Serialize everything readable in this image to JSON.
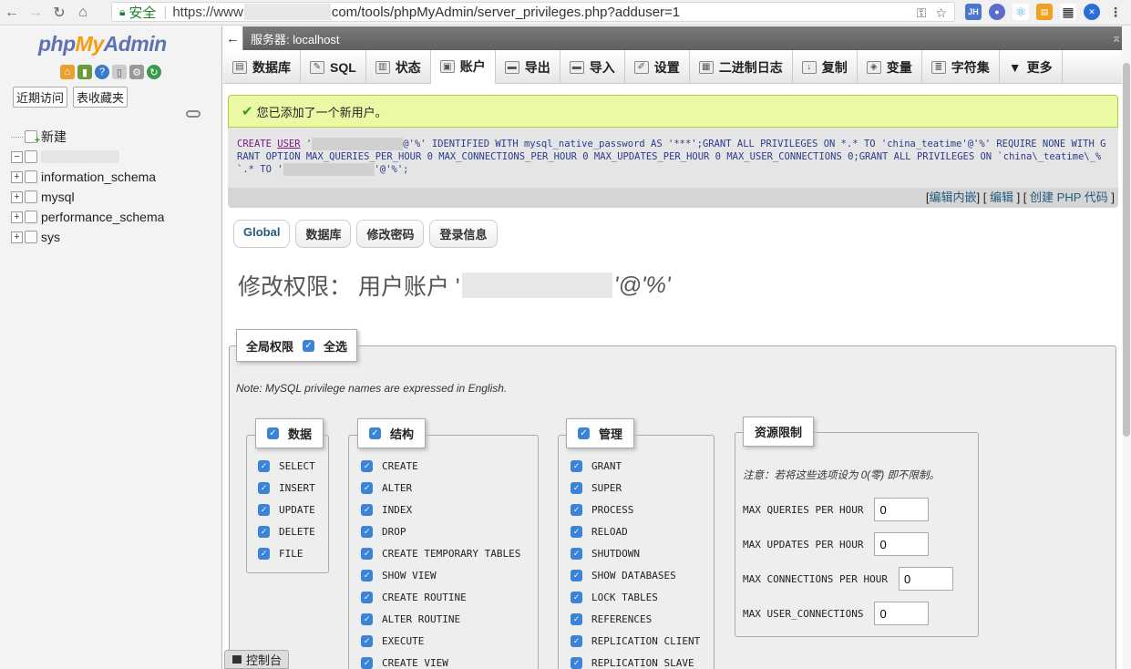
{
  "browser": {
    "secure_label": "安全",
    "url_prefix": "https://www",
    "url_suffix": "com/tools/phpMyAdmin/server_privileges.php?adduser=1"
  },
  "logo": {
    "php": "php",
    "my": "My",
    "admin": "Admin"
  },
  "leftnav": {
    "recent_label": "近期访问",
    "favorites_label": "表收藏夹",
    "tree": [
      {
        "label": "新建"
      },
      {
        "label": ""
      },
      {
        "label": "information_schema"
      },
      {
        "label": "mysql"
      },
      {
        "label": "performance_schema"
      },
      {
        "label": "sys"
      }
    ]
  },
  "serverbar": {
    "label": "服务器: localhost"
  },
  "tabs": [
    {
      "label": "数据库",
      "icon": "database-icon"
    },
    {
      "label": "SQL",
      "icon": "sql-icon"
    },
    {
      "label": "状态",
      "icon": "status-icon"
    },
    {
      "label": "账户",
      "icon": "accounts-icon"
    },
    {
      "label": "导出",
      "icon": "export-icon"
    },
    {
      "label": "导入",
      "icon": "import-icon"
    },
    {
      "label": "设置",
      "icon": "settings-icon"
    },
    {
      "label": "二进制日志",
      "icon": "binlog-icon"
    },
    {
      "label": "复制",
      "icon": "replication-icon"
    },
    {
      "label": "变量",
      "icon": "variables-icon"
    },
    {
      "label": "字符集",
      "icon": "charset-icon"
    },
    {
      "label": "更多",
      "icon": "more-icon"
    }
  ],
  "message": {
    "success": "您已添加了一个新用户。",
    "sql_1": "CREATE",
    "sql_2": "USER",
    "sql_3": "'",
    "sql_4": "@'%' IDENTIFIED WITH mysql_native_password AS '***';GRANT ALL PRIVILEGES ON *.* TO 'china_teatime'@'%' REQUIRE NONE WITH GRANT OPTION MAX_QUERIES_PER_HOUR 0 MAX_CONNECTIONS_PER_HOUR 0 MAX_UPDATES_PER_HOUR 0 MAX_USER_CONNECTIONS 0;GRANT ALL PRIVILEGES ON `china\\_teatime\\_%`.* TO '",
    "sql_5": "'@'%';",
    "edit_inline": "编辑内嵌",
    "edit": "编辑",
    "create_php": "创建 PHP 代码"
  },
  "subtabs": [
    "Global",
    "数据库",
    "修改密码",
    "登录信息"
  ],
  "page_title": {
    "prefix": "修改权限： 用户账户 '",
    "suffix": "'@'%'"
  },
  "global": {
    "legend": "全局权限",
    "select_all": "全选",
    "note": "Note: MySQL privilege names are expressed in English."
  },
  "data_group": {
    "legend": "数据",
    "privs": [
      "SELECT",
      "INSERT",
      "UPDATE",
      "DELETE",
      "FILE"
    ]
  },
  "structure_group": {
    "legend": "结构",
    "privs": [
      "CREATE",
      "ALTER",
      "INDEX",
      "DROP",
      "CREATE TEMPORARY TABLES",
      "SHOW VIEW",
      "CREATE ROUTINE",
      "ALTER ROUTINE",
      "EXECUTE",
      "CREATE VIEW"
    ]
  },
  "admin_group": {
    "legend": "管理",
    "privs": [
      "GRANT",
      "SUPER",
      "PROCESS",
      "RELOAD",
      "SHUTDOWN",
      "SHOW DATABASES",
      "LOCK TABLES",
      "REFERENCES",
      "REPLICATION CLIENT",
      "REPLICATION SLAVE"
    ]
  },
  "resource_group": {
    "legend": "资源限制",
    "note": "注意：若将这些选项设为 0(零) 即不限制。",
    "rows": [
      {
        "label": "MAX QUERIES PER HOUR",
        "value": "0"
      },
      {
        "label": "MAX UPDATES PER HOUR",
        "value": "0"
      },
      {
        "label": "MAX CONNECTIONS PER HOUR",
        "value": "0"
      },
      {
        "label": "MAX USER_CONNECTIONS",
        "value": "0"
      }
    ]
  },
  "console": {
    "label": "控制台"
  }
}
